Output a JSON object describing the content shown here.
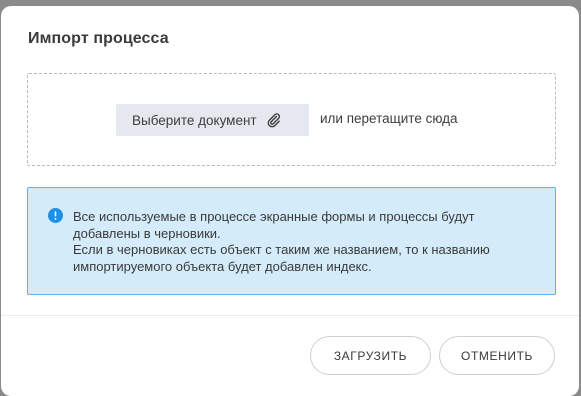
{
  "dialog": {
    "title": "Импорт процесса"
  },
  "dropzone": {
    "choose_label": "Выберите документ",
    "choose_icon": "paperclip-icon",
    "hint": "или перетащите сюда"
  },
  "info": {
    "icon": "info-circle-icon",
    "line1": "Все используемые в процессе экранные формы и процессы будут добавлены в черновики.",
    "line2": "Если в черновиках есть объект с таким же названием, то к названию импортируемого объекта будет добавлен индекс.",
    "accent_color": "#1e90e6",
    "background_color": "#d4ebfa"
  },
  "footer": {
    "upload_label": "ЗАГРУЗИТЬ",
    "cancel_label": "ОТМЕНИТЬ"
  }
}
